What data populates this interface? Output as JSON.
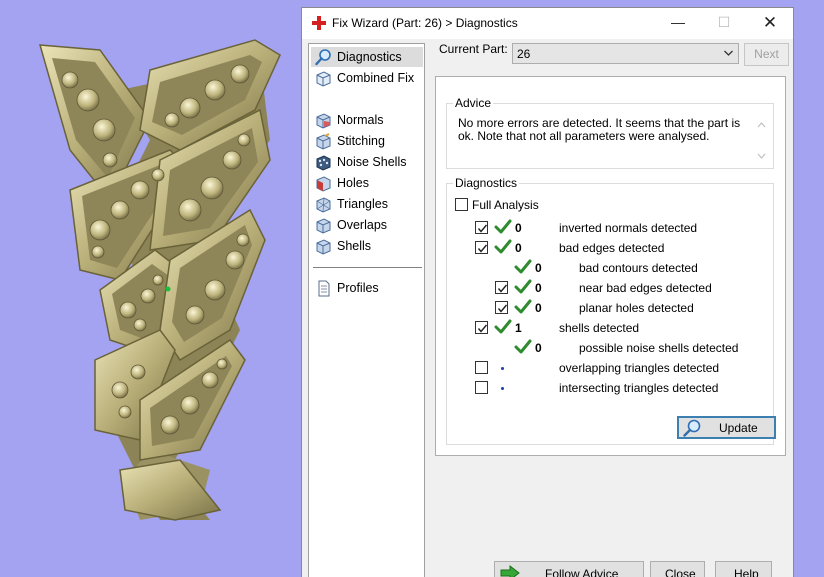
{
  "window": {
    "title": "Fix Wizard (Part: 26) > Diagnostics",
    "controls": {
      "minimize": "—",
      "maximize": "☐",
      "close": "✕"
    }
  },
  "nav": {
    "items": [
      {
        "label": "Diagnostics",
        "icon": "magnifier-icon",
        "selected": true
      },
      {
        "label": "Combined Fix",
        "icon": "cube-icon"
      },
      {
        "label": "Normals",
        "icon": "normals-cube-icon"
      },
      {
        "label": "Stitching",
        "icon": "stitching-cube-icon"
      },
      {
        "label": "Noise Shells",
        "icon": "noise-shells-icon"
      },
      {
        "label": "Holes",
        "icon": "holes-cube-icon"
      },
      {
        "label": "Triangles",
        "icon": "triangles-icon"
      },
      {
        "label": "Overlaps",
        "icon": "overlaps-cube-icon"
      },
      {
        "label": "Shells",
        "icon": "shells-cube-icon"
      },
      {
        "label": "Profiles",
        "icon": "document-icon"
      }
    ]
  },
  "part": {
    "label": "Current Part:",
    "value": "26",
    "next_label": "Next"
  },
  "advice": {
    "title": "Advice",
    "text": "No more errors are detected. It seems that the part is ok. Note that not all parameters were analysed."
  },
  "diagnostics": {
    "title": "Diagnostics",
    "full_analysis": {
      "label": "Full Analysis",
      "checked": false
    },
    "rows": [
      {
        "checkbox": true,
        "checked": true,
        "status": "ok",
        "count": "0",
        "label": "inverted normals detected",
        "indent": 0
      },
      {
        "checkbox": true,
        "checked": true,
        "status": "ok",
        "count": "0",
        "label": "bad edges detected",
        "indent": 0
      },
      {
        "checkbox": false,
        "checked": false,
        "status": "ok",
        "count": "0",
        "label": "bad contours detected",
        "indent": 1
      },
      {
        "checkbox": true,
        "checked": true,
        "status": "ok",
        "count": "0",
        "label": "near bad edges detected",
        "indent": 1
      },
      {
        "checkbox": true,
        "checked": true,
        "status": "ok",
        "count": "0",
        "label": "planar holes detected",
        "indent": 1
      },
      {
        "checkbox": true,
        "checked": true,
        "status": "ok",
        "count": "1",
        "label": "shells detected",
        "indent": 0
      },
      {
        "checkbox": false,
        "checked": false,
        "status": "ok",
        "count": "0",
        "label": "possible noise shells detected",
        "indent": 1
      },
      {
        "checkbox": true,
        "checked": false,
        "status": "pending",
        "count": "",
        "label": "overlapping triangles detected",
        "indent": 0
      },
      {
        "checkbox": true,
        "checked": false,
        "status": "pending",
        "count": "",
        "label": "intersecting triangles detected",
        "indent": 0
      }
    ],
    "update_label": "Update"
  },
  "buttons": {
    "follow_advice": "Follow Advice",
    "close": "Close",
    "help": "Help"
  },
  "colors": {
    "viewport_bg": "#a3a3f2",
    "model": "#c8c08a",
    "check_green": "#2e8b2e",
    "accent": "#3c7fb1"
  }
}
